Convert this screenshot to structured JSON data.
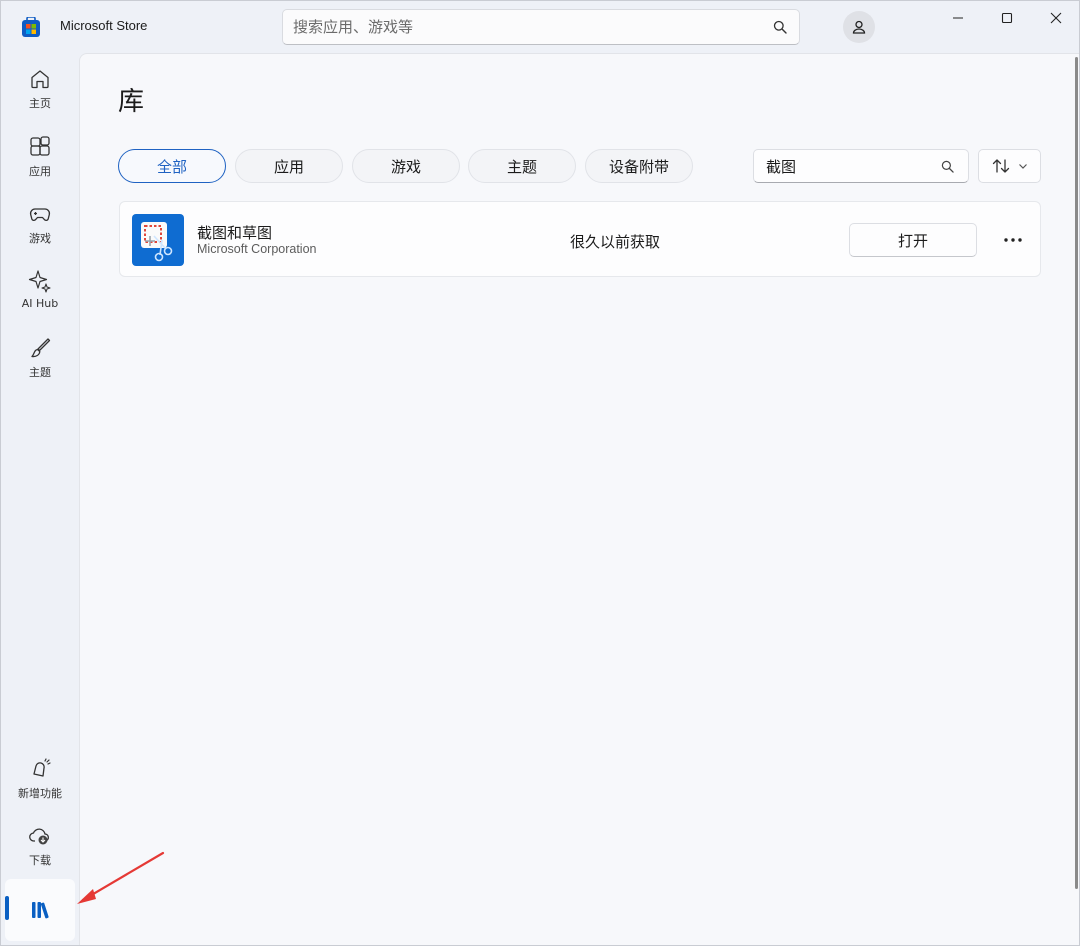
{
  "window": {
    "title": "Microsoft Store",
    "minimize_icon": "minimize-icon",
    "maximize_icon": "maximize-icon",
    "close_icon": "close-icon"
  },
  "search": {
    "placeholder": "搜索应用、游戏等",
    "icon": "search-icon"
  },
  "account": {
    "icon": "user-icon"
  },
  "sidebar": {
    "items": [
      {
        "label": "主页",
        "icon": "home-icon"
      },
      {
        "label": "应用",
        "icon": "apps-icon"
      },
      {
        "label": "游戏",
        "icon": "gamepad-icon"
      },
      {
        "label": "AI Hub",
        "icon": "sparkle-icon"
      },
      {
        "label": "主题",
        "icon": "brush-icon"
      }
    ],
    "bottom_items": [
      {
        "label": "新增功能",
        "icon": "bell-icon"
      },
      {
        "label": "下载",
        "icon": "download-cloud-icon"
      },
      {
        "label": "",
        "icon": "library-icon",
        "active": true
      }
    ]
  },
  "library": {
    "title": "库",
    "filters": [
      "全部",
      "应用",
      "游戏",
      "主题",
      "设备附带"
    ],
    "active_filter": "全部",
    "filter_search_value": "截图",
    "sort_icon": "sort-icon",
    "apps": [
      {
        "name": "截图和草图",
        "publisher": "Microsoft Corporation",
        "acquired": "很久以前获取",
        "action": "打开",
        "more_icon": "more-icon"
      }
    ]
  },
  "colors": {
    "accent": "#1f62c2",
    "window_bg": "#eef1f7",
    "content_bg": "#f7f8fb",
    "annotation_arrow": "#e53935"
  }
}
